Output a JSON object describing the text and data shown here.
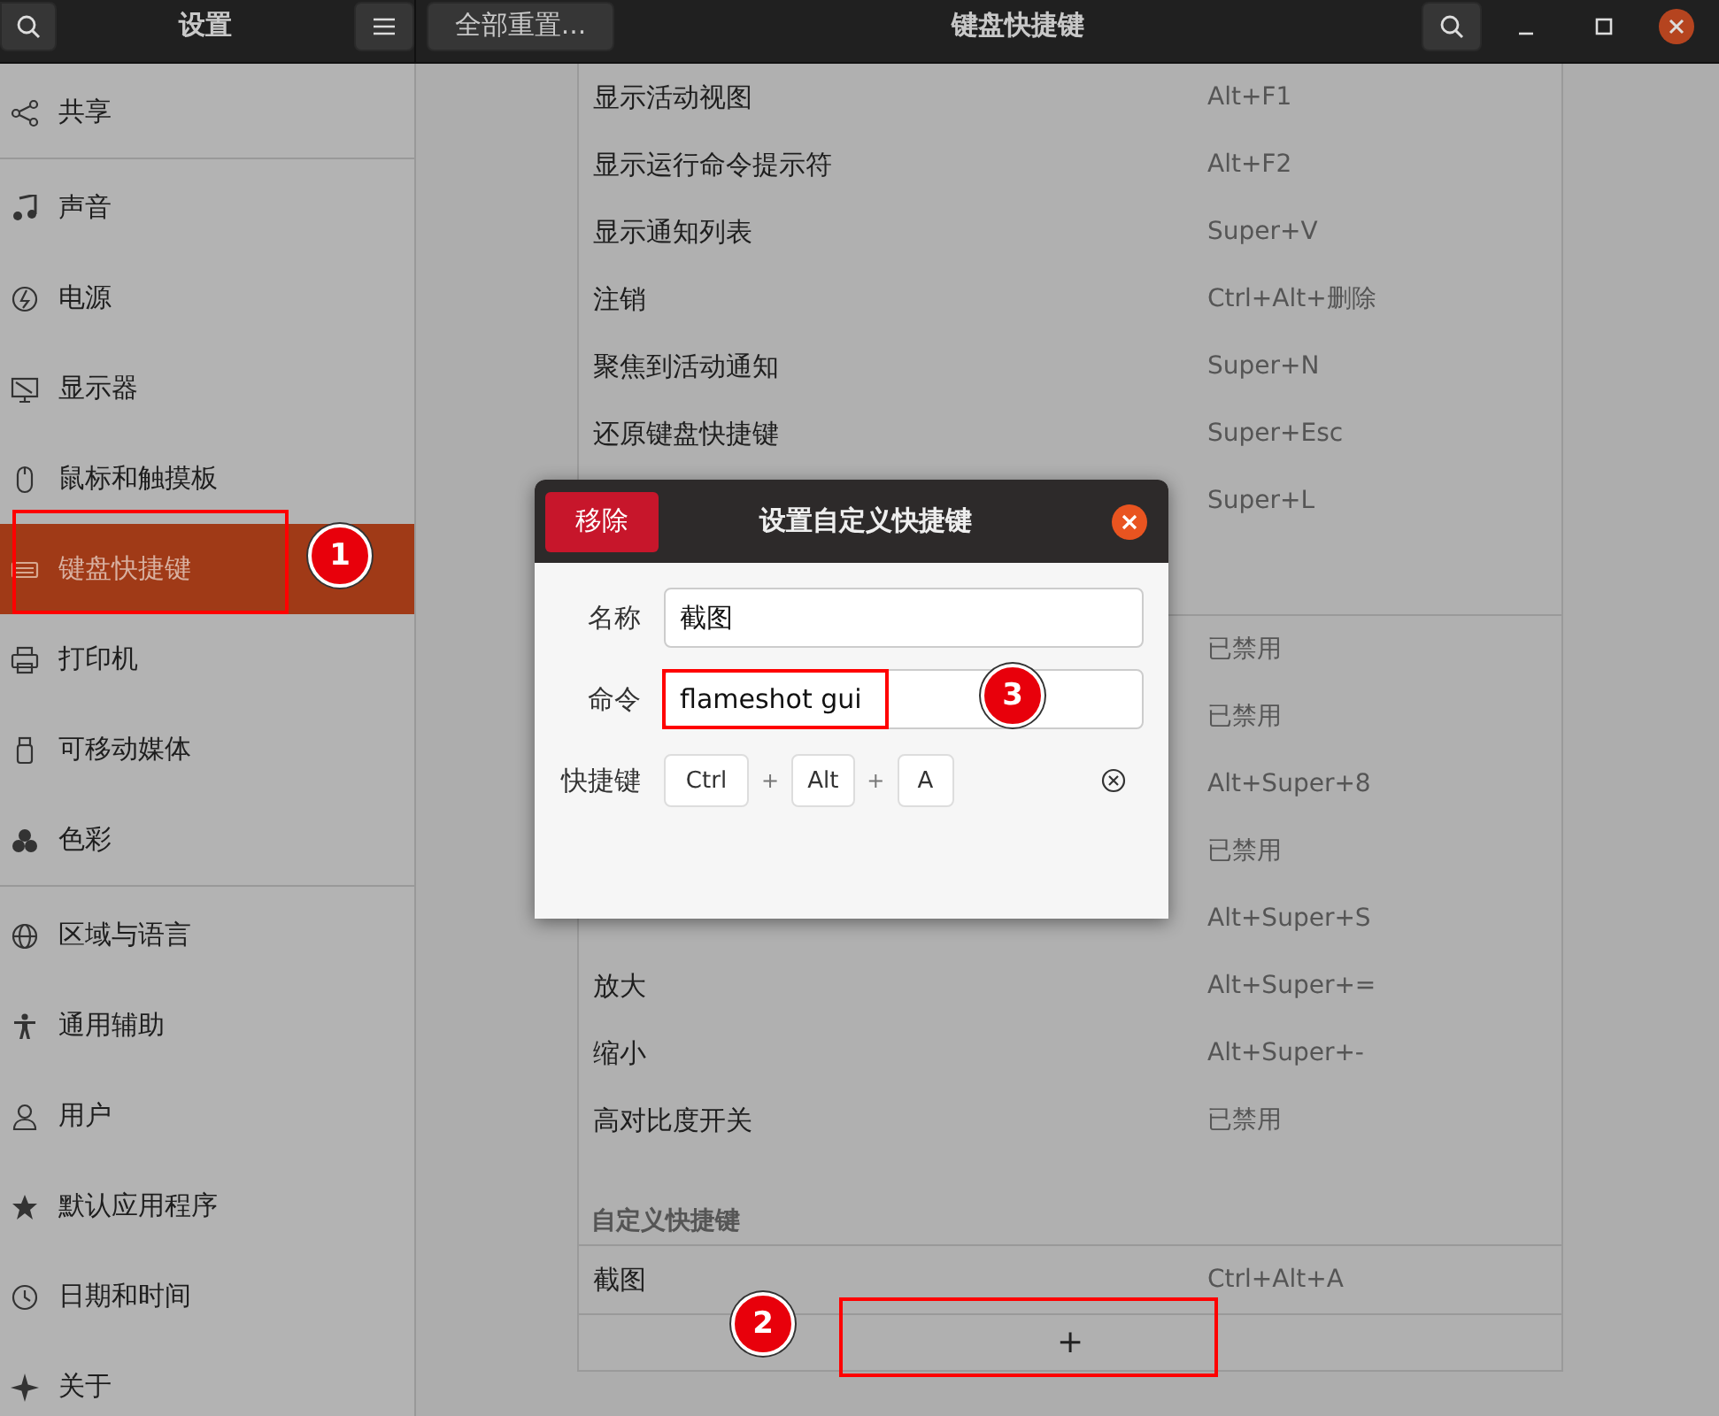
{
  "header": {
    "left_title": "设置",
    "reset_button": "全部重置...",
    "title": "键盘快捷键"
  },
  "sidebar": {
    "groups": [
      [
        {
          "label": "共享",
          "selected": false
        }
      ],
      [
        {
          "label": "声音",
          "selected": false
        },
        {
          "label": "电源",
          "selected": false
        },
        {
          "label": "显示器",
          "selected": false
        },
        {
          "label": "鼠标和触摸板",
          "selected": false
        },
        {
          "label": "键盘快捷键",
          "selected": true
        },
        {
          "label": "打印机",
          "selected": false
        },
        {
          "label": "可移动媒体",
          "selected": false
        },
        {
          "label": "色彩",
          "selected": false
        }
      ],
      [
        {
          "label": "区域与语言",
          "selected": false
        },
        {
          "label": "通用辅助",
          "selected": false
        },
        {
          "label": "用户",
          "selected": false
        },
        {
          "label": "默认应用程序",
          "selected": false
        },
        {
          "label": "日期和时间",
          "selected": false
        },
        {
          "label": "关于",
          "selected": false
        }
      ]
    ]
  },
  "sections": [
    {
      "rows": [
        {
          "name": "显示活动视图",
          "shortcut": "Alt+F1"
        },
        {
          "name": "显示运行命令提示符",
          "shortcut": "Alt+F2"
        },
        {
          "name": "显示通知列表",
          "shortcut": "Super+V"
        },
        {
          "name": "注销",
          "shortcut": "Ctrl+Alt+删除"
        },
        {
          "name": "聚焦到活动通知",
          "shortcut": "Super+N"
        },
        {
          "name": "还原键盘快捷键",
          "shortcut": "Super+Esc"
        },
        {
          "shortcut": "Super+L"
        }
      ]
    },
    {
      "rows": [
        {
          "shortcut": "已禁用"
        },
        {
          "shortcut": "已禁用"
        },
        {
          "shortcut": "Alt+Super+8"
        },
        {
          "shortcut": "已禁用"
        },
        {
          "shortcut": "Alt+Super+S"
        },
        {
          "name": "放大",
          "shortcut": "Alt+Super+="
        },
        {
          "name": "缩小",
          "shortcut": "Alt+Super+-"
        },
        {
          "name": "高对比度开关",
          "shortcut": "已禁用"
        }
      ]
    },
    {
      "title": "自定义快捷键",
      "rows": [
        {
          "name": "截图",
          "shortcut": "Ctrl+Alt+A"
        }
      ]
    }
  ],
  "add_button": "+",
  "dialog": {
    "remove_button": "移除",
    "title": "设置自定义快捷键",
    "fields": [
      {
        "label": "名称",
        "value": "截图"
      },
      {
        "label": "命令",
        "value": "flameshot gui"
      }
    ],
    "shortcut_label": "快捷键",
    "keys": [
      "Ctrl",
      "Alt",
      "A"
    ],
    "key_separator": "+"
  },
  "annotations": [
    {
      "label": "1"
    },
    {
      "label": "2"
    },
    {
      "label": "3"
    }
  ]
}
